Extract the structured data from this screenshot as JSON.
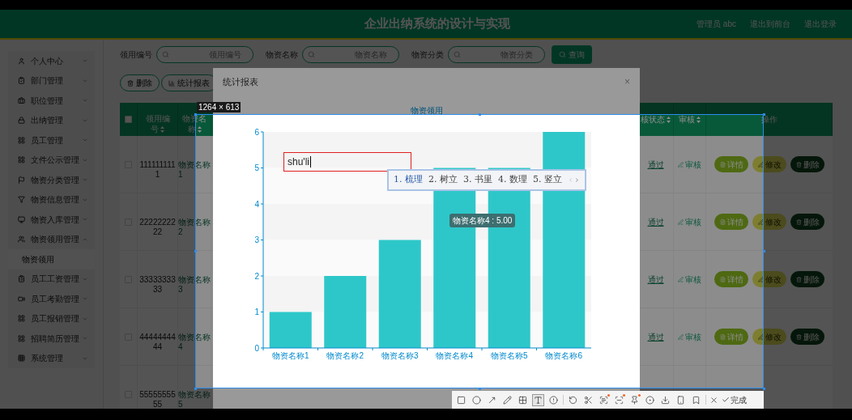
{
  "header": {
    "title": "企业出纳系统的设计与实现",
    "user": "管理员 abc",
    "links": [
      "退出到前台",
      "退出登录"
    ]
  },
  "sidebar": {
    "items": [
      {
        "label": "个人中心",
        "expanded": false
      },
      {
        "label": "部门管理",
        "expanded": false
      },
      {
        "label": "职位管理",
        "expanded": false
      },
      {
        "label": "出纳管理",
        "expanded": false
      },
      {
        "label": "员工管理",
        "expanded": false
      },
      {
        "label": "文件公示管理",
        "expanded": false
      },
      {
        "label": "物资分类管理",
        "expanded": false
      },
      {
        "label": "物资信息管理",
        "expanded": false
      },
      {
        "label": "物资入库管理",
        "expanded": false
      },
      {
        "label": "物资领用管理",
        "expanded": true,
        "children": [
          {
            "label": "物资领用",
            "selected": true
          }
        ]
      },
      {
        "label": "员工工资管理",
        "expanded": false
      },
      {
        "label": "员工考勤管理",
        "expanded": false
      },
      {
        "label": "员工报销管理",
        "expanded": false
      },
      {
        "label": "招聘简历管理",
        "expanded": false
      },
      {
        "label": "系统管理",
        "expanded": false
      }
    ]
  },
  "filters": [
    {
      "label": "领用编号",
      "placeholder": "领用编号"
    },
    {
      "label": "物资名称",
      "placeholder": "物资名称"
    },
    {
      "label": "物资分类",
      "placeholder": "物资分类"
    }
  ],
  "search_button": "查询",
  "actions": [
    "删除",
    "统计报表"
  ],
  "table": {
    "select_all": {
      "checked": false
    },
    "columns": [
      {
        "label": "领用编号",
        "sortable": true
      },
      {
        "label": "物资名称",
        "sortable": true
      },
      {
        "label": "核状态",
        "sortable": true
      },
      {
        "label": "审核",
        "sortable": true
      },
      {
        "label": "操作",
        "sortable": false
      }
    ],
    "rows": [
      {
        "checked": false,
        "id": "1111111111",
        "name": "物资名称1",
        "status": "通过",
        "review": "审核",
        "operations": [
          "详情",
          "修改",
          "删除"
        ]
      },
      {
        "checked": false,
        "id": "2222222222",
        "name": "物资名称2",
        "status": "通过",
        "review": "审核",
        "operations": [
          "详情",
          "修改",
          "删除"
        ]
      },
      {
        "checked": false,
        "id": "3333333333",
        "name": "物资名称3",
        "status": "通过",
        "review": "审核",
        "operations": [
          "详情",
          "修改",
          "删除"
        ]
      },
      {
        "checked": false,
        "id": "4444444444",
        "name": "物资名称4",
        "status": "通过",
        "review": "审核",
        "operations": [
          "详情",
          "修改",
          "删除"
        ]
      },
      {
        "checked": false,
        "id": "5555555555",
        "name": "物资名称5"
      }
    ]
  },
  "dialog": {
    "title": "统计报表",
    "close": "×",
    "chart_data": {
      "type": "bar",
      "title": "物资领用",
      "categories": [
        "物资名称1",
        "物资名称2",
        "物资名称3",
        "物资名称4",
        "物资名称5",
        "物资名称6"
      ],
      "series": [
        {
          "color": "#2ec7c9",
          "values": [
            1,
            2,
            3,
            5,
            5,
            6
          ]
        }
      ],
      "ylim": [
        0,
        6
      ],
      "yticks": [
        0,
        1,
        2,
        3,
        4,
        5,
        6
      ]
    },
    "tooltip": "物资名称4 : 5.00"
  },
  "screenshot_tool": {
    "size_label": "1264 × 613",
    "annotation_text": "shu'li",
    "ime_candidates": [
      {
        "text": "1. 梳理",
        "selected": true
      },
      {
        "text": "2. 树立",
        "selected": false
      },
      {
        "text": "3. 书里",
        "selected": false
      },
      {
        "text": "4. 数理",
        "selected": false
      },
      {
        "text": "5. 竖立",
        "selected": false
      }
    ],
    "tools": [
      {
        "selected": false,
        "badge": false
      },
      {
        "selected": false,
        "badge": false
      },
      {
        "selected": false,
        "badge": false
      },
      {
        "selected": false,
        "badge": false
      },
      {
        "selected": false,
        "badge": false
      },
      {
        "selected": true,
        "badge": false
      },
      {
        "selected": false,
        "badge": false
      },
      {
        "selected": false,
        "badge": false
      },
      {
        "selected": false,
        "badge": false
      },
      {
        "selected": false,
        "badge": true
      },
      {
        "selected": false,
        "badge": true
      },
      {
        "selected": false,
        "badge": true
      },
      {
        "selected": false,
        "badge": false
      },
      {
        "selected": false,
        "badge": false
      },
      {
        "selected": false,
        "badge": false
      },
      {
        "selected": false,
        "badge": false
      }
    ],
    "done_label": "完成"
  }
}
